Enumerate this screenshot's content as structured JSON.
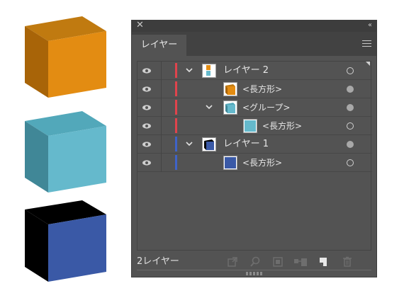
{
  "cubes": [
    {
      "name": "orange-cube",
      "top": "#c07a10",
      "front": "#e38c12",
      "side": "#a86408"
    },
    {
      "name": "cyan-cube",
      "top": "#52a8ba",
      "front": "#65b9cc",
      "side": "#408797"
    },
    {
      "name": "blue-cube",
      "top": "#000000",
      "front": "#3a59a6",
      "side": "#000000"
    }
  ],
  "panel": {
    "tab_label": "レイヤー",
    "footer_label": "2レイヤー",
    "rows": [
      {
        "label": "レイヤー 2",
        "color": "#e0444c",
        "target": "hollow",
        "icons": [
          "eye-icon",
          "chevron-down-icon",
          "layer-thumbnail-icon",
          "target-circle-icon"
        ]
      },
      {
        "label": "<長方形>",
        "color": "#e0444c",
        "target": "filled"
      },
      {
        "label": "<グループ>",
        "color": "#e0444c",
        "target": "filled"
      },
      {
        "label": "<長方形>",
        "color": "#e0444c",
        "target": "hollow"
      },
      {
        "label": "レイヤー 1",
        "color": "#3f63c8",
        "target": "filled"
      },
      {
        "label": "<長方形>",
        "color": "#3f63c8",
        "target": "hollow"
      }
    ]
  }
}
